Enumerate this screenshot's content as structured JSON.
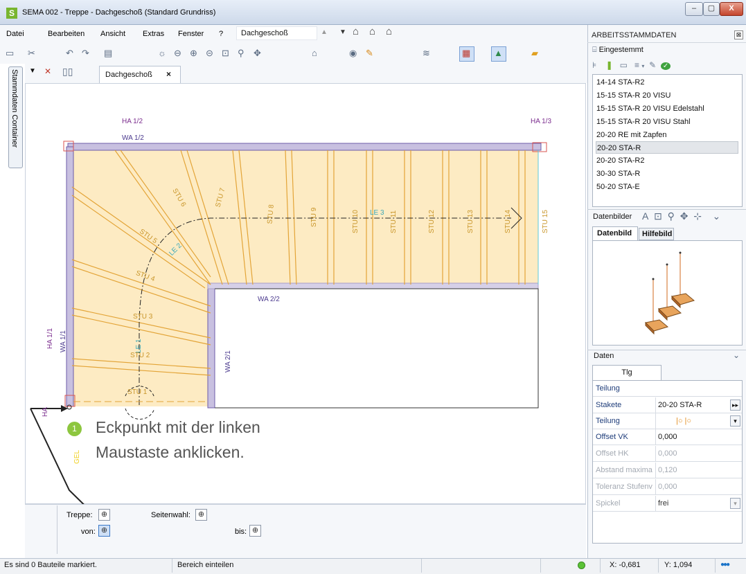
{
  "window": {
    "title": "SEMA  002 - Treppe  - Dachgeschoß (Standard Grundriss)",
    "logo": "S",
    "buttons": {
      "minimize": "–",
      "maximize": "▢",
      "close": "X"
    }
  },
  "menu": {
    "items": [
      "Datei",
      "Bearbeiten",
      "Ansicht",
      "Extras",
      "Fenster",
      "?"
    ],
    "floor_select": "Dachgeschoß"
  },
  "sidebar_tab": "Stammdaten Container",
  "document_tab": {
    "label": "Dachgeschoß",
    "close": "×"
  },
  "drawing": {
    "labels": {
      "ha12": "HA 1/2",
      "wa12": "WA 1/2",
      "ha13": "HA 1/3",
      "ha11": "HA 1/1",
      "wa11": "WA 1/1",
      "wa22": "WA 2/2",
      "wa21": "WA 2/1",
      "le1": "LE 1",
      "le2": "LE 2",
      "le3": "LE 3",
      "ha_bottom": "HA",
      "gel": "GEL"
    },
    "steps": [
      "STU 1",
      "STU 2",
      "STU 3",
      "STU 4",
      "STU 5",
      "STU 6",
      "STU 7",
      "STU 8",
      "STU 9",
      "STU 10",
      "STU 11",
      "STU 12",
      "STU 13",
      "STU 14",
      "STU 15"
    ]
  },
  "callout": {
    "number": "1",
    "line1": "Eckpunkt mit der linken",
    "line2": "Maustaste anklicken."
  },
  "bottom_panel": {
    "treppe_label": "Treppe:",
    "seitenwahl_label": "Seitenwahl:",
    "von_label": "von:",
    "bis_label": "bis:"
  },
  "status": {
    "message": "Es sind 0 Bauteile markiert.",
    "mode": "Bereich einteilen",
    "x": "X: -0,681",
    "y": "Y: 1,094"
  },
  "right_panel": {
    "title": "ARBEITSSTAMMDATEN",
    "category": "Eingestemmt",
    "items": [
      "14-14 STA-R2",
      "15-15 STA-R 20 VISU",
      "15-15 STA-R 20 VISU Edelstahl",
      "15-15 STA-R 20 VISU Stahl",
      "20-20 RE mit Zapfen",
      "20-20 STA-R",
      "20-20 STA-R2",
      "30-30 STA-R",
      "50-20 STA-E"
    ],
    "selected_index": 5,
    "datenbilder_title": "Datenbilder",
    "tabs": [
      "Datenbild",
      "Hilfebild"
    ],
    "daten_title": "Daten",
    "daten_tab": "Tlg",
    "properties": [
      {
        "key": "Teilung",
        "value": ""
      },
      {
        "key": "Stakete",
        "value": "20-20 STA-R"
      },
      {
        "key": "Teilung",
        "value": "|○    |○"
      },
      {
        "key": "Offset VK",
        "value": "0,000"
      },
      {
        "key": "Offset HK",
        "value": "0,000"
      },
      {
        "key": "Abstand maxima",
        "value": "0,120"
      },
      {
        "key": "Toleranz Stufenv",
        "value": "0,000"
      },
      {
        "key": "Spickel",
        "value": "frei"
      }
    ]
  }
}
